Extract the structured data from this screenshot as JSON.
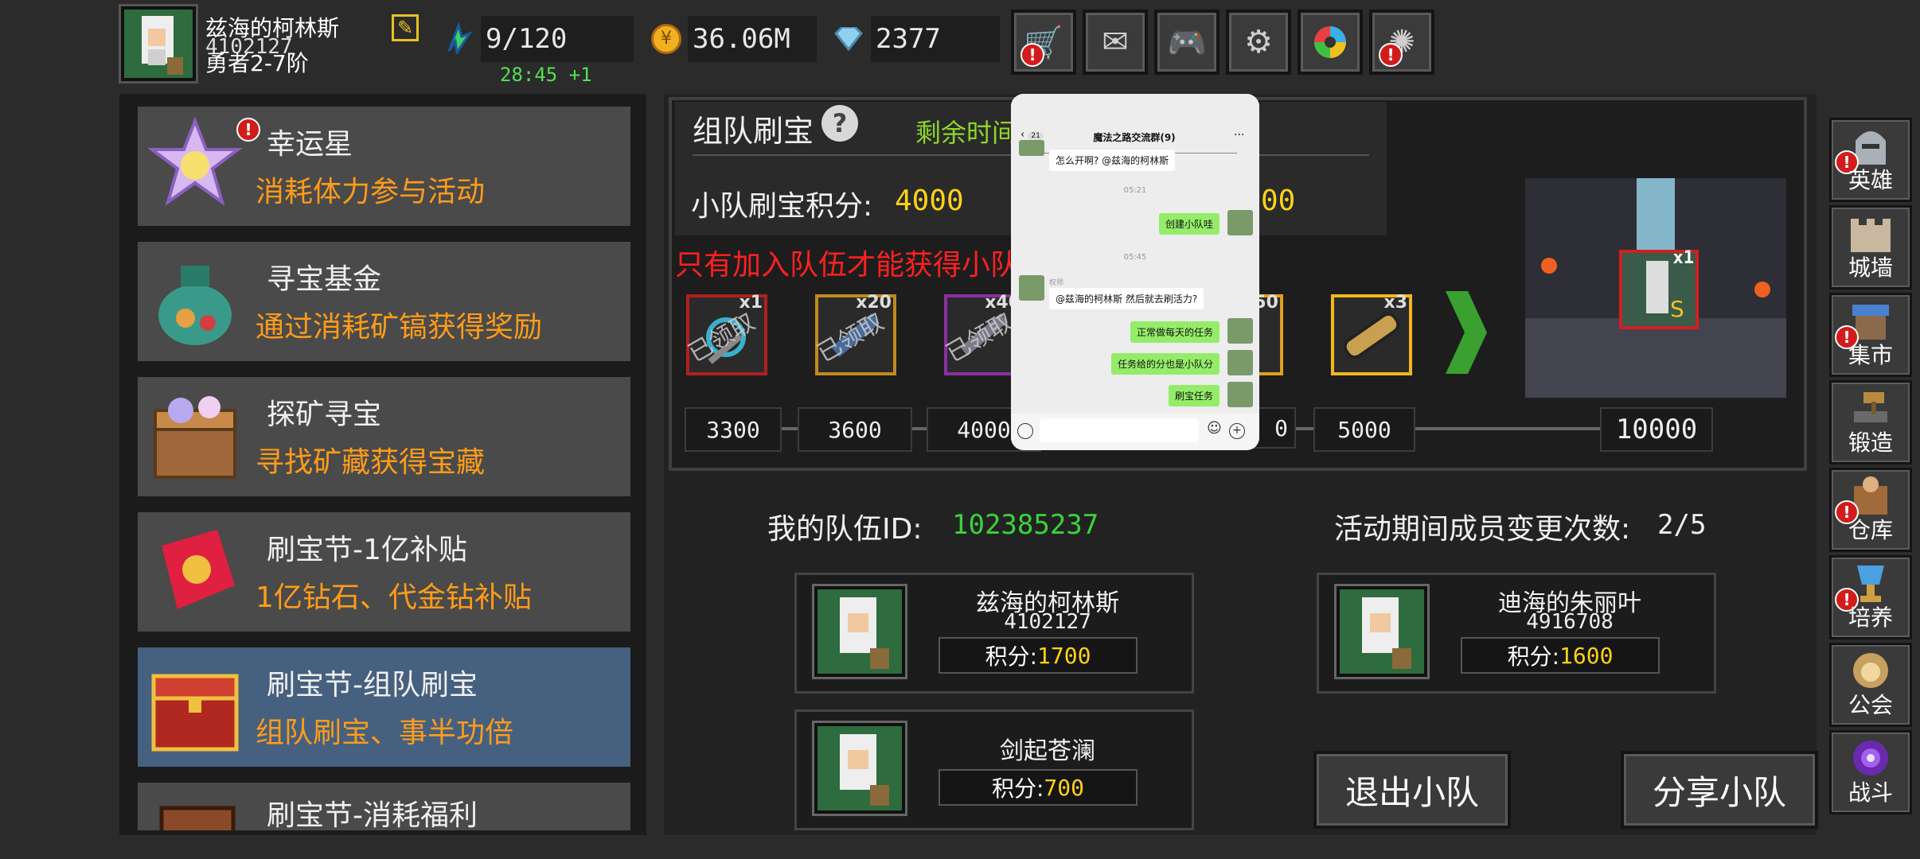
{
  "player": {
    "name": "兹海的柯林斯",
    "id": "4102127",
    "rank": "勇者2-7阶"
  },
  "stamina": {
    "value": "9/120",
    "timer": "28:45 +1"
  },
  "gold": "36.06M",
  "diamonds": "2377",
  "top_buttons": [
    "shop-cart-icon",
    "mail-icon",
    "gamepad-icon",
    "gear-icon",
    "color-wheel-icon",
    "fireworks-icon"
  ],
  "menu": [
    {
      "title": "幸运星",
      "sub": "消耗体力参与活动",
      "badge": "!"
    },
    {
      "title": "寻宝基金",
      "sub": "通过消耗矿镐获得奖励"
    },
    {
      "title": "探矿寻宝",
      "sub": "寻找矿藏获得宝藏"
    },
    {
      "title": "刷宝节-1亿补贴",
      "sub": "1亿钻石、代金钻补贴"
    },
    {
      "title": "刷宝节-组队刷宝",
      "sub": "组队刷宝、事半功倍"
    },
    {
      "title": "刷宝节-消耗福利",
      "sub": ""
    }
  ],
  "event": {
    "title": "组队刷宝",
    "help": "?",
    "remaining_label": "剩余时间",
    "team_score_label": "小队刷宝积分:",
    "team_score": "4000",
    "score_tail": "00",
    "warning": "只有加入队伍才能获得小队",
    "rewards": [
      {
        "count": "x1",
        "claimed": "已领取"
      },
      {
        "count": "x20",
        "claimed": "已领取"
      },
      {
        "count": "x40",
        "claimed": "已领取"
      },
      {
        "count": "50",
        "claimed": ""
      },
      {
        "count": "x3",
        "claimed": ""
      }
    ],
    "thresholds": [
      "3300",
      "3600",
      "4000",
      "0",
      "5000"
    ],
    "final_threshold": "10000",
    "final_count": "x1"
  },
  "team": {
    "id_label": "我的队伍ID:",
    "id": "102385237",
    "changes_label": "活动期间成员变更次数:",
    "changes": "2/5",
    "score_label": "积分:",
    "members": [
      {
        "name": "兹海的柯林斯",
        "uid": "4102127",
        "score": "1700"
      },
      {
        "name": "迪海的朱丽叶",
        "uid": "4916708",
        "score": "1600"
      },
      {
        "name": "剑起苍澜",
        "uid": "",
        "score": "700"
      }
    ],
    "quit_label": "退出小队",
    "share_label": "分享小队"
  },
  "side_nav": [
    {
      "label": "英雄",
      "badge": true
    },
    {
      "label": "城墙",
      "badge": false
    },
    {
      "label": "集市",
      "badge": true
    },
    {
      "label": "锻造",
      "badge": false
    },
    {
      "label": "仓库",
      "badge": true
    },
    {
      "label": "培养",
      "badge": true
    },
    {
      "label": "公会",
      "badge": false
    },
    {
      "label": "战斗",
      "badge": false
    }
  ],
  "chat": {
    "back_count": "21",
    "title": "魔法之路交流群(9)",
    "more": "···",
    "messages": [
      {
        "from": "other",
        "text": "怎么开啊? @兹海的柯林斯"
      },
      {
        "time": "05:21"
      },
      {
        "from": "me",
        "text": "创建小队哇"
      },
      {
        "time": "05:45"
      },
      {
        "from": "other",
        "sender": "权师",
        "text": "@兹海的柯林斯 然后就去刷活力?"
      },
      {
        "from": "me",
        "text": "正常做每天的任务"
      },
      {
        "from": "me",
        "text": "任务给的分也是小队分"
      },
      {
        "from": "me",
        "text": "刷宝任务"
      }
    ]
  },
  "colors": {
    "accent_orange": "#ff9c1a",
    "score_yellow": "#ffd21a",
    "id_green": "#3bd23b",
    "warning_red": "#ff2020",
    "timer_green": "#52e052",
    "remaining_green": "#8fd62a"
  }
}
